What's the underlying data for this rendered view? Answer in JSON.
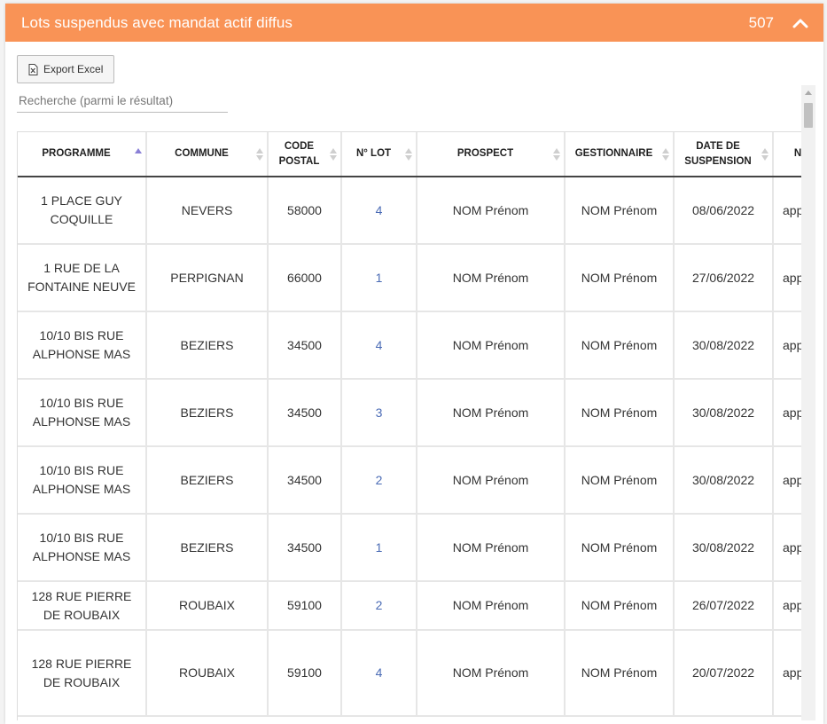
{
  "header": {
    "title": "Lots suspendus avec mandat actif diffus",
    "count": "507",
    "collapse_icon": "chevron-up-icon",
    "color": "#f99356"
  },
  "toolbar": {
    "export_label": "Export Excel",
    "export_icon": "excel-file-icon"
  },
  "search": {
    "placeholder": "Recherche (parmi le résultat)"
  },
  "table": {
    "columns": [
      {
        "label": "PROGRAMME",
        "sort": "asc"
      },
      {
        "label": "COMMUNE",
        "sort": "none"
      },
      {
        "label": "CODE POSTAL",
        "sort": "none"
      },
      {
        "label": "N° LOT",
        "sort": "none"
      },
      {
        "label": "PROSPECT",
        "sort": "none"
      },
      {
        "label": "GESTIONNAIRE",
        "sort": "none"
      },
      {
        "label": "DATE DE SUSPENSION",
        "sort": "none"
      },
      {
        "label": "N",
        "sort": "none"
      }
    ],
    "rows": [
      {
        "programme": "1 PLACE GUY COQUILLE",
        "commune": "NEVERS",
        "code_postal": "58000",
        "lot": "4",
        "prospect": "NOM Prénom",
        "gestionnaire": "NOM Prénom",
        "date": "08/06/2022",
        "extra": "app"
      },
      {
        "programme": "1 RUE DE LA FONTAINE NEUVE",
        "commune": "PERPIGNAN",
        "code_postal": "66000",
        "lot": "1",
        "prospect": "NOM Prénom",
        "gestionnaire": "NOM Prénom",
        "date": "27/06/2022",
        "extra": "app"
      },
      {
        "programme": "10/10 BIS RUE ALPHONSE MAS",
        "commune": "BEZIERS",
        "code_postal": "34500",
        "lot": "4",
        "prospect": "NOM Prénom",
        "gestionnaire": "NOM Prénom",
        "date": "30/08/2022",
        "extra": "app"
      },
      {
        "programme": "10/10 BIS RUE ALPHONSE MAS",
        "commune": "BEZIERS",
        "code_postal": "34500",
        "lot": "3",
        "prospect": "NOM Prénom",
        "gestionnaire": "NOM Prénom",
        "date": "30/08/2022",
        "extra": "app"
      },
      {
        "programme": "10/10 BIS RUE ALPHONSE MAS",
        "commune": "BEZIERS",
        "code_postal": "34500",
        "lot": "2",
        "prospect": "NOM Prénom",
        "gestionnaire": "NOM Prénom",
        "date": "30/08/2022",
        "extra": "app"
      },
      {
        "programme": "10/10 BIS RUE ALPHONSE MAS",
        "commune": "BEZIERS",
        "code_postal": "34500",
        "lot": "1",
        "prospect": "NOM Prénom",
        "gestionnaire": "NOM Prénom",
        "date": "30/08/2022",
        "extra": "app"
      },
      {
        "programme": "128 RUE PIERRE DE ROUBAIX",
        "commune": "ROUBAIX",
        "code_postal": "59100",
        "lot": "2",
        "prospect": "NOM Prénom",
        "gestionnaire": "NOM Prénom",
        "date": "26/07/2022",
        "extra": "app"
      },
      {
        "programme": "128 RUE PIERRE DE ROUBAIX",
        "commune": "ROUBAIX",
        "code_postal": "59100",
        "lot": "4",
        "prospect": "NOM Prénom",
        "gestionnaire": "NOM Prénom",
        "date": "20/07/2022",
        "extra": "app"
      }
    ]
  }
}
